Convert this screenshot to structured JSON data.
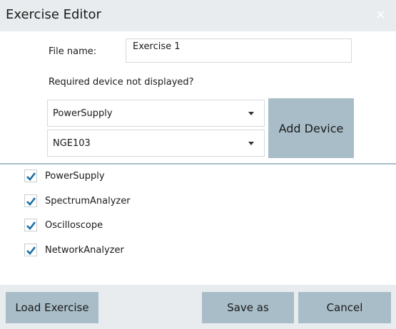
{
  "window": {
    "title": "Exercise Editor",
    "close_glyph": "×"
  },
  "form": {
    "filename_label": "File name:",
    "filename_value": "Exercise 1",
    "device_hint": "Required device not displayed?",
    "device_type_selected": "PowerSupply",
    "device_model_selected": "NGE103",
    "add_device_label": "Add Device"
  },
  "devices": [
    {
      "label": "PowerSupply",
      "checked": true
    },
    {
      "label": "SpectrumAnalyzer",
      "checked": true
    },
    {
      "label": "Oscilloscope",
      "checked": true
    },
    {
      "label": "NetworkAnalyzer",
      "checked": true
    }
  ],
  "footer": {
    "load_label": "Load Exercise",
    "save_label": "Save as",
    "cancel_label": "Cancel"
  },
  "colors": {
    "button_bg": "#a9bdc8",
    "titlebar_bg": "#e8ecef",
    "check_color": "#1c6ea4",
    "divider": "#a8bdc9"
  },
  "icons": {
    "close": "close-icon",
    "dropdown": "chevron-down-icon",
    "check": "checkmark-icon"
  }
}
